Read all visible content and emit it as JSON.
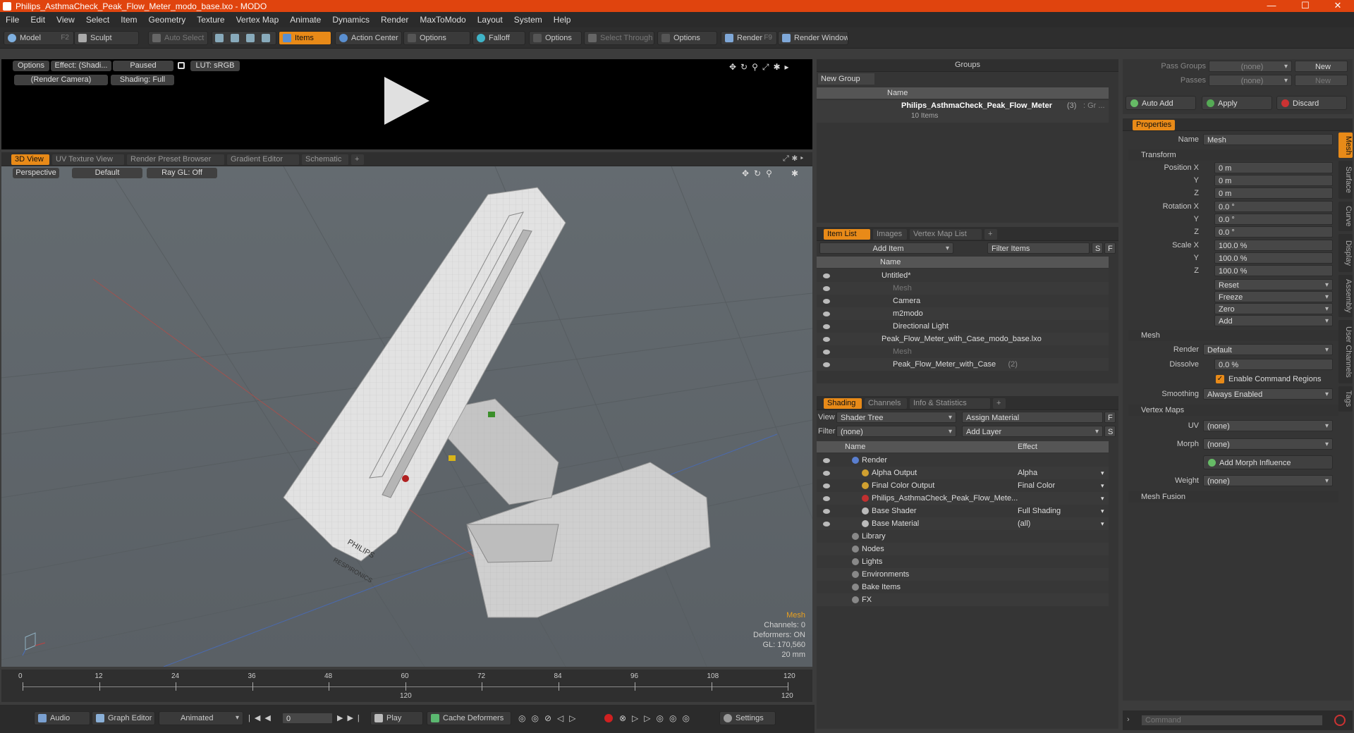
{
  "window": {
    "title": "Philips_AsthmaCheck_Peak_Flow_Meter_modo_base.lxo - MODO"
  },
  "menu": [
    "File",
    "Edit",
    "View",
    "Select",
    "Item",
    "Geometry",
    "Texture",
    "Vertex Map",
    "Animate",
    "Dynamics",
    "Render",
    "MaxToModo",
    "Layout",
    "System",
    "Help"
  ],
  "toolbar": {
    "model": "Model",
    "model_key": "F2",
    "sculpt": "Sculpt",
    "auto_select": "Auto Select",
    "items": "Items",
    "action_center": "Action Center",
    "options1": "Options",
    "falloff": "Falloff",
    "options2": "Options",
    "select_through": "Select Through",
    "options3": "Options",
    "render": "Render",
    "render_key": "F9",
    "render_window": "Render Window"
  },
  "preview": {
    "options": "Options",
    "effect": "Effect: (Shadi...",
    "paused": "Paused",
    "lut": "LUT: sRGB",
    "camera": "(Render Camera)",
    "shading": "Shading: Full"
  },
  "viewport": {
    "tabs": [
      "3D View",
      "UV Texture View",
      "Render Preset Browser",
      "Gradient Editor",
      "Schematic",
      "+"
    ],
    "perspective": "Perspective",
    "default": "Default",
    "raygl": "Ray GL: Off",
    "info_title": "Mesh",
    "channels": "Channels: 0",
    "deformers": "Deformers: ON",
    "gl": "GL: 170,560",
    "scale": "20 mm",
    "model_labels": {
      "brand": "PHILIPS",
      "sub": "RESPIRONICS"
    },
    "colors": {
      "accent": "#e88a18",
      "background": "#5f666b",
      "grid": "#4f5559"
    }
  },
  "timeline": {
    "ticks": [
      "0",
      "12",
      "24",
      "36",
      "48",
      "60",
      "72",
      "84",
      "96",
      "108",
      "120"
    ],
    "mid": "120",
    "end": "120"
  },
  "bottombar": {
    "audio": "Audio",
    "graph": "Graph Editor",
    "animated": "Animated",
    "frame": "0",
    "play": "Play",
    "cache": "Cache Deformers",
    "settings": "Settings"
  },
  "groups": {
    "title": "Groups",
    "new_group": "New Group",
    "col_name": "Name",
    "item": "Philips_AsthmaCheck_Peak_Flow_Meter",
    "item_count": "(3)",
    "item_suffix": ": Gr ...",
    "sub": "10 Items"
  },
  "itemlist": {
    "tabs": [
      "Item List",
      "Images",
      "Vertex Map List",
      "+"
    ],
    "add_item": "Add Item",
    "filter": "Filter Items",
    "col_name": "Name",
    "s": "S",
    "f": "F",
    "rows": [
      {
        "label": "Untitled*",
        "indent": 0
      },
      {
        "label": "Mesh",
        "indent": 2,
        "dim": true
      },
      {
        "label": "Camera",
        "indent": 2
      },
      {
        "label": "m2modo",
        "indent": 2
      },
      {
        "label": "Directional Light",
        "indent": 2
      },
      {
        "label": "Peak_Flow_Meter_with_Case_modo_base.lxo",
        "indent": 0
      },
      {
        "label": "Mesh",
        "indent": 2,
        "dim": true
      },
      {
        "label": "Peak_Flow_Meter_with_Case",
        "indent": 2,
        "count": "(2)"
      }
    ]
  },
  "shading": {
    "tabs": [
      "Shading",
      "Channels",
      "Info & Statistics",
      "+"
    ],
    "view_label": "View",
    "view": "Shader Tree",
    "assign": "Assign Material",
    "f": "F",
    "filter_label": "Filter",
    "filter": "(none)",
    "add_layer": "Add Layer",
    "s": "S",
    "col_name": "Name",
    "col_effect": "Effect",
    "rows": [
      {
        "label": "Render",
        "effect": "",
        "indent": 0
      },
      {
        "label": "Alpha Output",
        "effect": "Alpha",
        "indent": 1
      },
      {
        "label": "Final Color Output",
        "effect": "Final Color",
        "indent": 1
      },
      {
        "label": "Philips_AsthmaCheck_Peak_Flow_Mete...",
        "effect": "",
        "indent": 1
      },
      {
        "label": "Base Shader",
        "effect": "Full Shading",
        "indent": 1
      },
      {
        "label": "Base Material",
        "effect": "(all)",
        "indent": 1
      },
      {
        "label": "Library",
        "effect": "",
        "indent": 0
      },
      {
        "label": "Nodes",
        "effect": "",
        "indent": 0
      },
      {
        "label": "Lights",
        "effect": "",
        "indent": 0
      },
      {
        "label": "Environments",
        "effect": "",
        "indent": 0
      },
      {
        "label": "Bake Items",
        "effect": "",
        "indent": 0
      },
      {
        "label": "FX",
        "effect": "",
        "indent": 0
      }
    ]
  },
  "passes": {
    "pass_groups": "Pass Groups",
    "passes": "Passes",
    "none": "(none)",
    "new": "New",
    "auto_add": "Auto Add",
    "apply": "Apply",
    "discard": "Discard"
  },
  "properties": {
    "tab": "Properties",
    "name_label": "Name",
    "name": "Mesh",
    "transform": "Transform",
    "position_label": "Position X",
    "rotation_label": "Rotation X",
    "scale_label": "Scale X",
    "y": "Y",
    "z": "Z",
    "pos": [
      "0 m",
      "0 m",
      "0 m"
    ],
    "rot": [
      "0.0 °",
      "0.0 °",
      "0.0 °"
    ],
    "scl": [
      "100.0 %",
      "100.0 %",
      "100.0 %"
    ],
    "actions": [
      "Reset",
      "Freeze",
      "Zero",
      "Add"
    ],
    "mesh_section": "Mesh",
    "render_label": "Render",
    "render": "Default",
    "dissolve_label": "Dissolve",
    "dissolve": "0.0 %",
    "enable_cmd": "Enable Command Regions",
    "smoothing_label": "Smoothing",
    "smoothing": "Always Enabled",
    "vertex_maps": "Vertex Maps",
    "uv_label": "UV",
    "uv": "(none)",
    "morph_label": "Morph",
    "morph": "(none)",
    "add_morph": "Add Morph Influence",
    "weight_label": "Weight",
    "weight": "(none)",
    "mesh_fusion": "Mesh Fusion",
    "side_tabs": [
      "Mesh",
      "Surface",
      "Curve",
      "Display",
      "Assembly",
      "User Channels",
      "Tags"
    ]
  },
  "command": {
    "placeholder": "Command"
  }
}
